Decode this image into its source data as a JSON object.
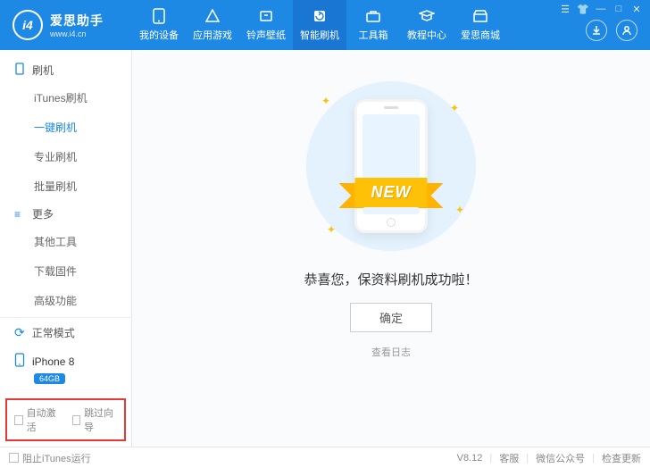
{
  "logo": {
    "icon_text": "i4",
    "title": "爱思助手",
    "url": "www.i4.cn"
  },
  "nav": [
    {
      "label": "我的设备"
    },
    {
      "label": "应用游戏"
    },
    {
      "label": "铃声壁纸"
    },
    {
      "label": "智能刷机"
    },
    {
      "label": "工具箱"
    },
    {
      "label": "教程中心"
    },
    {
      "label": "爱思商城"
    }
  ],
  "sidebar": {
    "group1": {
      "title": "刷机",
      "items": [
        "iTunes刷机",
        "一键刷机",
        "专业刷机",
        "批量刷机"
      ]
    },
    "group2": {
      "title": "更多",
      "items": [
        "其他工具",
        "下载固件",
        "高级功能"
      ]
    },
    "mode": "正常模式",
    "device": {
      "name": "iPhone 8",
      "storage": "64GB"
    },
    "checks": {
      "auto_activate": "自动激活",
      "skip_guide": "跳过向导"
    }
  },
  "main": {
    "ribbon": "NEW",
    "success": "恭喜您，保资料刷机成功啦！",
    "ok": "确定",
    "view_log": "查看日志"
  },
  "footer": {
    "block_itunes": "阻止iTunes运行",
    "version": "V8.12",
    "service": "客服",
    "wechat": "微信公众号",
    "update": "检查更新"
  }
}
